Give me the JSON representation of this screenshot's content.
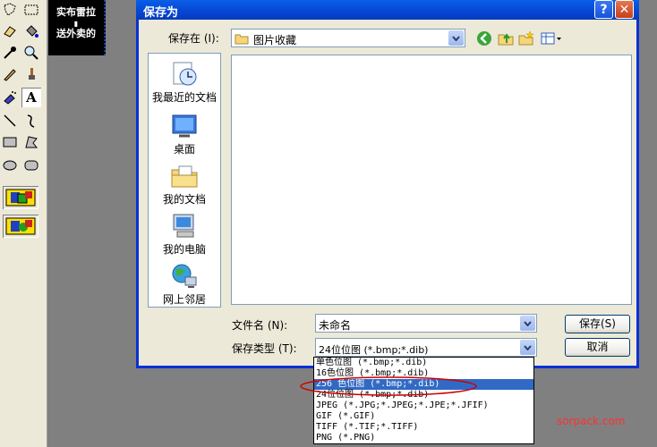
{
  "canvas": {
    "line1": "实布雷拉",
    "line2": "送外卖的"
  },
  "dialog": {
    "title": "保存为",
    "help_label": "?",
    "close_label": "✕",
    "save_in_label": "保存在 (I):",
    "save_in_value": "图片收藏",
    "places": [
      {
        "label": "我最近的文档",
        "icon": "recent-docs-icon"
      },
      {
        "label": "桌面",
        "icon": "desktop-icon"
      },
      {
        "label": "我的文档",
        "icon": "my-documents-icon"
      },
      {
        "label": "我的电脑",
        "icon": "my-computer-icon"
      },
      {
        "label": "网上邻居",
        "icon": "network-icon"
      }
    ],
    "filename_label": "文件名 (N):",
    "filename_value": "未命名",
    "filetype_label": "保存类型 (T):",
    "filetype_value": "24位位图 (*.bmp;*.dib)",
    "save_button": "保存(S)",
    "cancel_button": "取消",
    "filetype_options": [
      "单色位图 (*.bmp;*.dib)",
      "16色位图 (*.bmp;*.dib)",
      "256 色位图 (*.bmp;*.dib)",
      "24位位图 (*.bmp;*.dib)",
      "JPEG (*.JPG;*.JPEG;*.JPE;*.JFIF)",
      "GIF (*.GIF)",
      "TIFF (*.TIF;*.TIFF)",
      "PNG (*.PNG)"
    ],
    "selected_option_index": 2
  },
  "watermark": "sorpack.com",
  "colors": {
    "title_blue": "#0646d4",
    "selection": "#316ac5",
    "highlight_ellipse": "#cc0000",
    "watermark": "#ff3030"
  }
}
